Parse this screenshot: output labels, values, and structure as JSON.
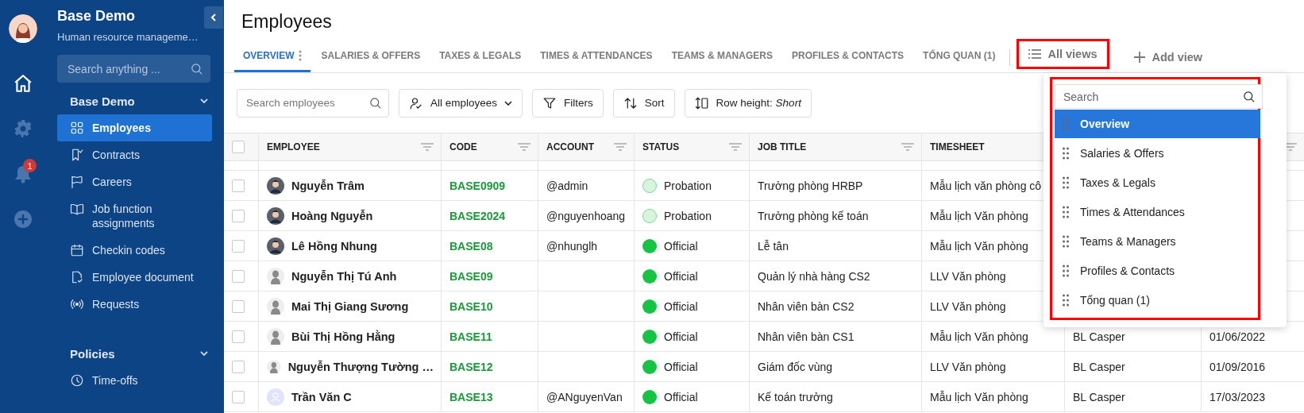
{
  "rail": {
    "notification_badge": "1"
  },
  "sidebar": {
    "title": "Base Demo",
    "subtitle": "Human resource manageme…",
    "search": {
      "placeholder": "Search anything ..."
    },
    "groups": [
      {
        "title": "Base Demo",
        "expanded": true,
        "items": [
          {
            "label": "Employees",
            "selected": true
          },
          {
            "label": "Contracts",
            "selected": false
          },
          {
            "label": "Careers",
            "selected": false
          },
          {
            "label": "Job function assignments",
            "selected": false
          },
          {
            "label": "Checkin codes",
            "selected": false
          },
          {
            "label": "Employee document",
            "selected": false
          },
          {
            "label": "Requests",
            "selected": false
          }
        ]
      },
      {
        "title": "Policies",
        "expanded": true,
        "items": [
          {
            "label": "Time-offs",
            "selected": false
          }
        ]
      }
    ]
  },
  "page": {
    "title": "Employees"
  },
  "tabs": [
    {
      "label": "OVERVIEW",
      "selected": true,
      "menu": true
    },
    {
      "label": "SALARIES & OFFERS",
      "selected": false,
      "menu": false
    },
    {
      "label": "TAXES & LEGALS",
      "selected": false,
      "menu": false
    },
    {
      "label": "TIMES & ATTENDANCES",
      "selected": false,
      "menu": false
    },
    {
      "label": "TEAMS & MANAGERS",
      "selected": false,
      "menu": false
    },
    {
      "label": "PROFILES & CONTACTS",
      "selected": false,
      "menu": false
    },
    {
      "label": "TỔNG QUAN (1)",
      "selected": false,
      "menu": false
    }
  ],
  "view_actions": {
    "all_views": "All views",
    "add_view": "Add view"
  },
  "toolbar": {
    "search": {
      "placeholder": "Search employees"
    },
    "scope": "All employees",
    "filters": "Filters",
    "sort": "Sort",
    "row_height": "Row height: *Short*"
  },
  "table": {
    "select_all": false,
    "columns": [
      "EMPLOYEE",
      "CODE",
      "ACCOUNT",
      "STATUS",
      "JOB TITLE",
      "TIMESHEET"
    ],
    "rows": [
      {
        "checked": false,
        "employee": "Nguyễn Trâm",
        "code": "BASE0909",
        "account": "@admin",
        "status": {
          "kind": "probation",
          "label": "Probation"
        },
        "job_title": "Trưởng phòng HRBP",
        "timesheet": "Mẫu lịch văn phòng cô"
      },
      {
        "checked": false,
        "employee": "Hoàng Nguyễn",
        "code": "BASE2024",
        "account": "@nguyenhoang",
        "status": {
          "kind": "probation",
          "label": "Probation"
        },
        "job_title": "Trưởng phòng kế toán",
        "timesheet": "Mẫu lịch Văn phòng"
      },
      {
        "checked": false,
        "employee": "Lê Hồng Nhung",
        "code": "BASE08",
        "account": "@nhunglh",
        "status": {
          "kind": "official",
          "label": "Official"
        },
        "job_title": "Lễ tân",
        "timesheet": "Mẫu lịch Văn phòng"
      },
      {
        "checked": false,
        "avatar": {
          "kind": "silhouette"
        },
        "employee": "Nguyễn Thị Tú Anh",
        "code": "BASE09",
        "status": {
          "kind": "official",
          "label": "Official"
        },
        "job_title": "Quản lý nhà hàng CS2",
        "timesheet": "LLV Văn phòng"
      },
      {
        "checked": false,
        "avatar": {
          "kind": "silhouette"
        },
        "employee": "Mai Thị Giang Sương",
        "code": "BASE10",
        "status": {
          "kind": "official",
          "label": "Official"
        },
        "job_title": "Nhân viên bàn CS2",
        "timesheet": "LLV Văn phòng"
      },
      {
        "checked": false,
        "avatar": {
          "kind": "silhouette"
        },
        "employee": "Bùi Thị Hồng Hằng",
        "code": "BASE11",
        "status": {
          "kind": "official",
          "label": "Official"
        },
        "job_title": "Nhân viên bàn CS1",
        "timesheet": "Mẫu lịch Văn phòng",
        "column_7": "BL Casper",
        "column_8": "01/06/2022"
      },
      {
        "checked": false,
        "avatar": {
          "kind": "silhouette"
        },
        "employee": "Nguyễn Thượng Tường …",
        "code": "BASE12",
        "status": {
          "kind": "official",
          "label": "Official"
        },
        "job_title": "Giám đốc vùng",
        "timesheet": "LLV Văn phòng",
        "column_7": "BL Casper",
        "column_8": "01/09/2016"
      },
      {
        "checked": false,
        "avatar": {
          "kind": "placeholder"
        },
        "employee": "Trần Văn C",
        "code": "BASE13",
        "account": "@ANguyenVan",
        "status": {
          "kind": "official",
          "label": "Official"
        },
        "job_title": "Kế toán trưởng",
        "timesheet": "Mẫu lịch Văn phòng",
        "column_7": "BL Casper",
        "column_8": "17/03/2023"
      }
    ]
  },
  "views_menu": {
    "search": {
      "placeholder": "Search"
    },
    "items": [
      {
        "label": "Overview",
        "selected": true
      },
      {
        "label": "Salaries & Offers",
        "selected": false
      },
      {
        "label": "Taxes & Legals",
        "selected": false
      },
      {
        "label": "Times & Attendances",
        "selected": false
      },
      {
        "label": "Teams & Managers",
        "selected": false
      },
      {
        "label": "Profiles & Contacts",
        "selected": false
      },
      {
        "label": "Tổng quan (1)",
        "selected": false
      }
    ]
  }
}
